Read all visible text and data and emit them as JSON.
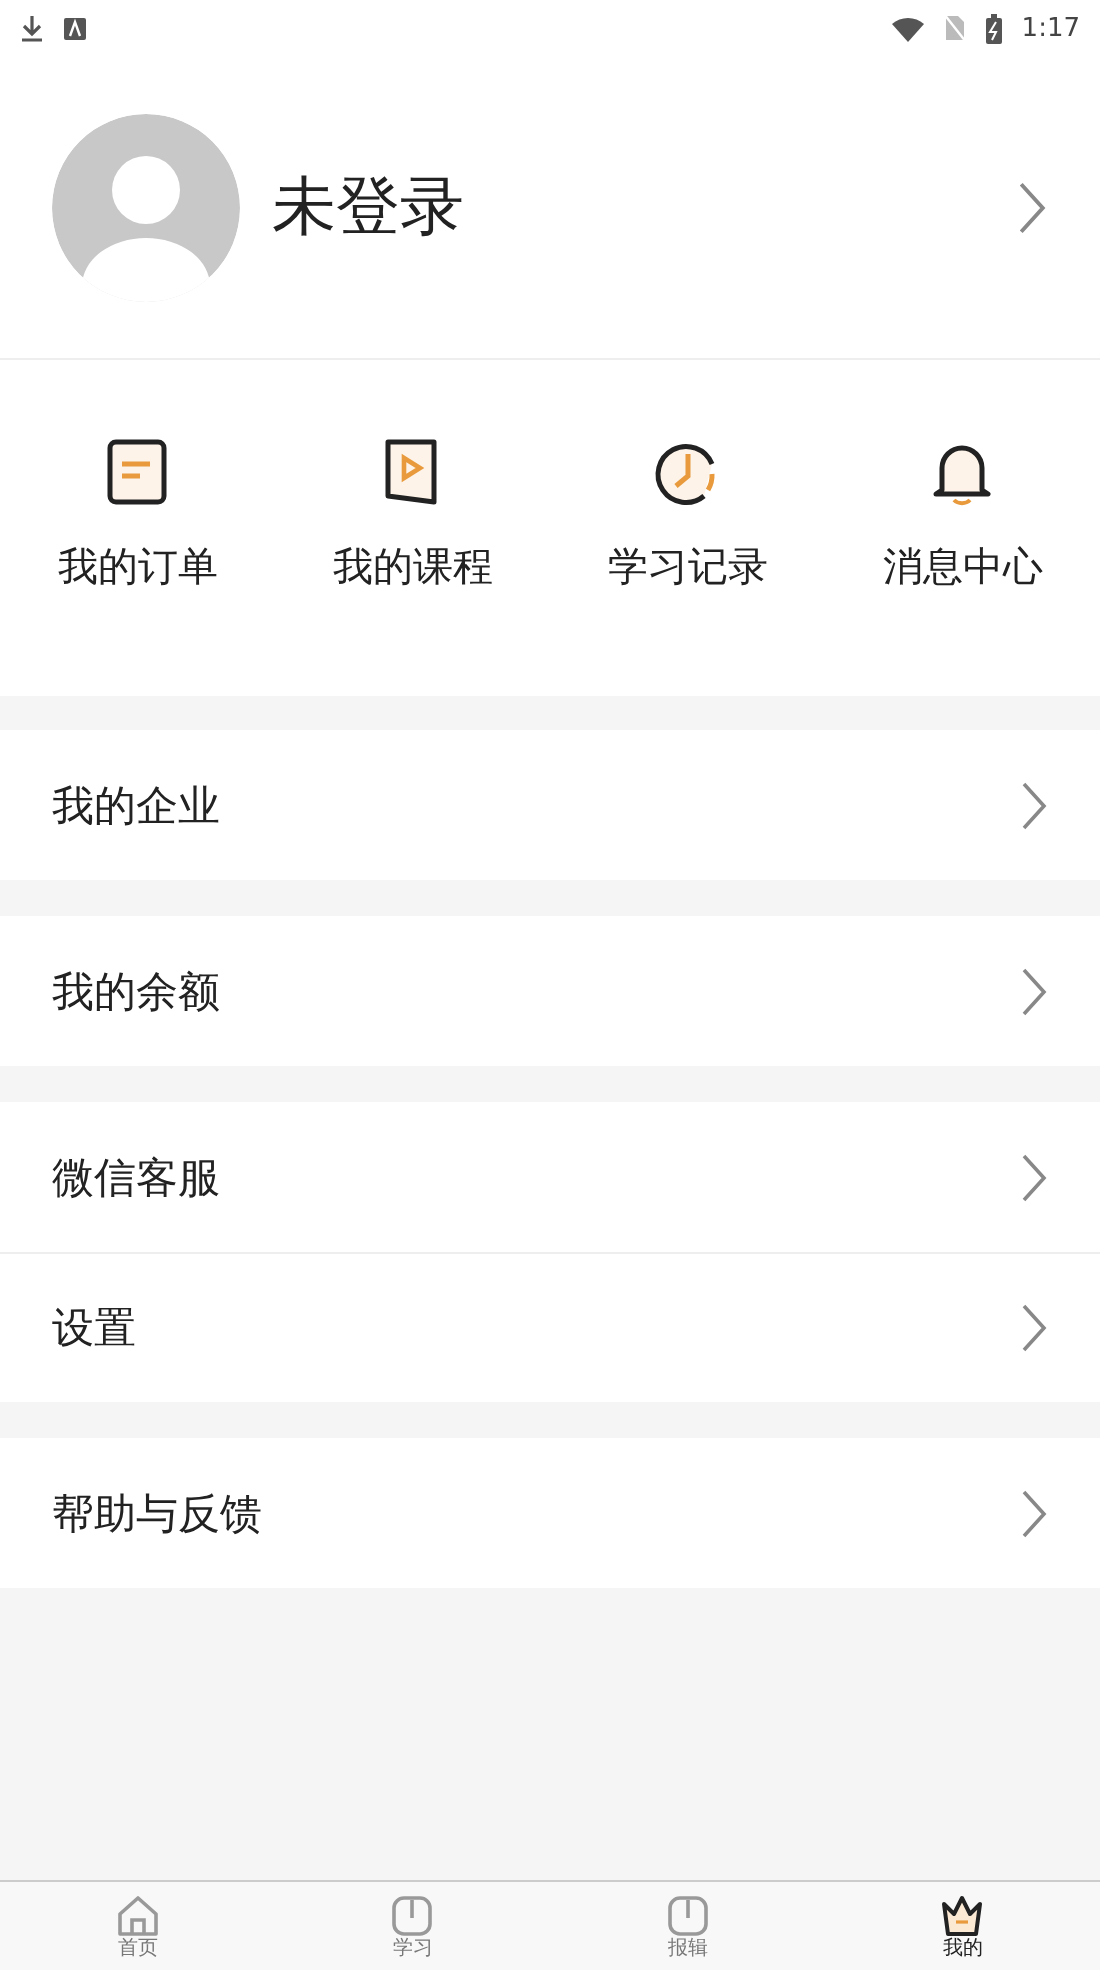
{
  "status_bar": {
    "time": "1:17"
  },
  "profile": {
    "name": "未登录"
  },
  "shortcuts": [
    {
      "label": "我的订单",
      "kind": "order"
    },
    {
      "label": "我的课程",
      "kind": "course"
    },
    {
      "label": "学习记录",
      "kind": "history"
    },
    {
      "label": "消息中心",
      "kind": "bell"
    }
  ],
  "menu_groups": [
    {
      "items": [
        {
          "label": "我的企业"
        }
      ]
    },
    {
      "items": [
        {
          "label": "我的余额"
        }
      ]
    },
    {
      "items": [
        {
          "label": "微信客服"
        },
        {
          "label": "设置"
        }
      ]
    },
    {
      "items": [
        {
          "label": "帮助与反馈"
        }
      ]
    }
  ],
  "tab_bar": [
    {
      "label": "首页",
      "kind": "home",
      "selected": false
    },
    {
      "label": "学习",
      "kind": "book",
      "selected": false
    },
    {
      "label": "报辑",
      "kind": "book",
      "selected": false
    },
    {
      "label": "我的",
      "kind": "crown",
      "selected": true
    }
  ]
}
